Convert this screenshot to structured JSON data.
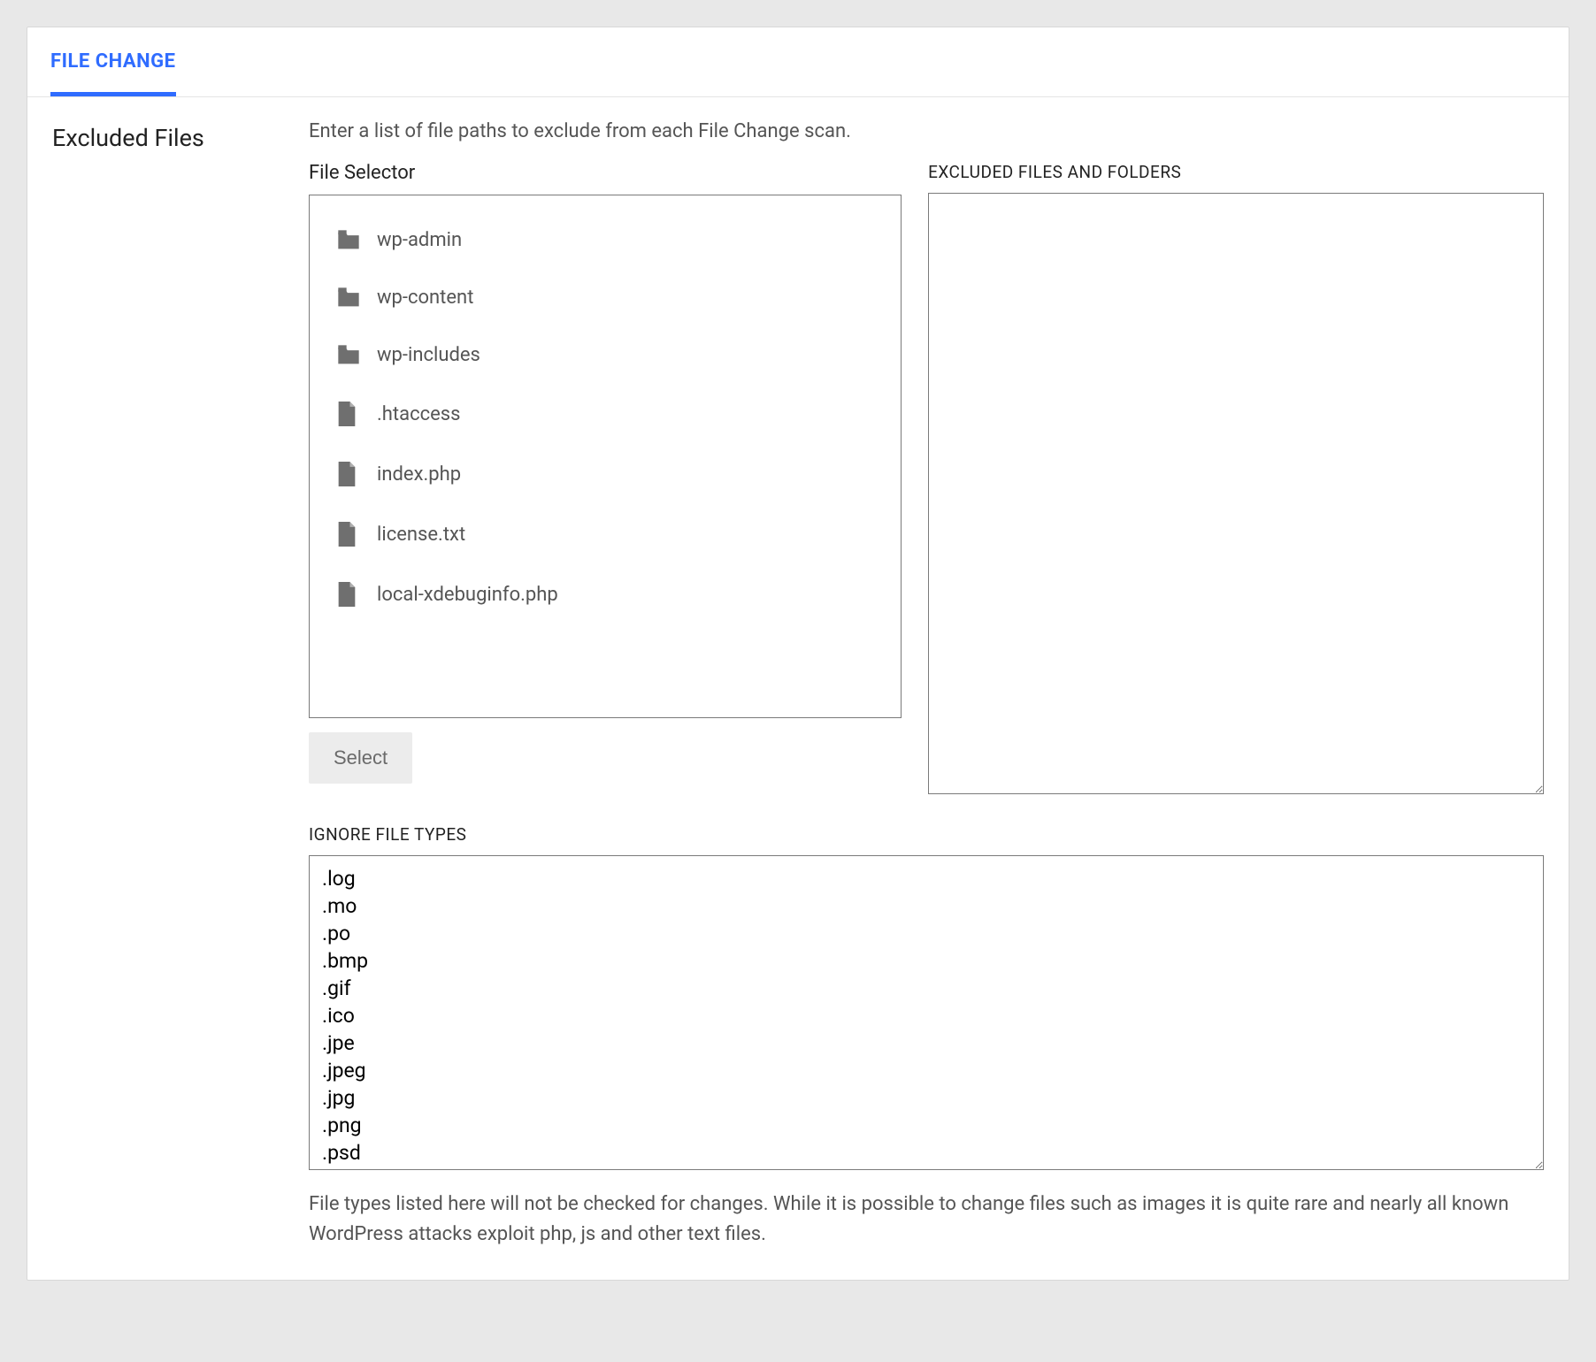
{
  "tab": {
    "label": "FILE CHANGE"
  },
  "section": {
    "title": "Excluded Files",
    "description": "Enter a list of file paths to exclude from each File Change scan."
  },
  "fileSelector": {
    "label": "File Selector",
    "items": [
      {
        "type": "folder",
        "name": "wp-admin"
      },
      {
        "type": "folder",
        "name": "wp-content"
      },
      {
        "type": "folder",
        "name": "wp-includes"
      },
      {
        "type": "file",
        "name": ".htaccess"
      },
      {
        "type": "file",
        "name": "index.php"
      },
      {
        "type": "file",
        "name": "license.txt"
      },
      {
        "type": "file",
        "name": "local-xdebuginfo.php"
      }
    ],
    "button": "Select"
  },
  "excluded": {
    "label": "EXCLUDED FILES AND FOLDERS",
    "value": ""
  },
  "ignore": {
    "label": "IGNORE FILE TYPES",
    "value": ".log\n.mo\n.po\n.bmp\n.gif\n.ico\n.jpe\n.jpeg\n.jpg\n.png\n.psd",
    "help": "File types listed here will not be checked for changes. While it is possible to change files such as images it is quite rare and nearly all known WordPress attacks exploit php, js and other text files."
  }
}
